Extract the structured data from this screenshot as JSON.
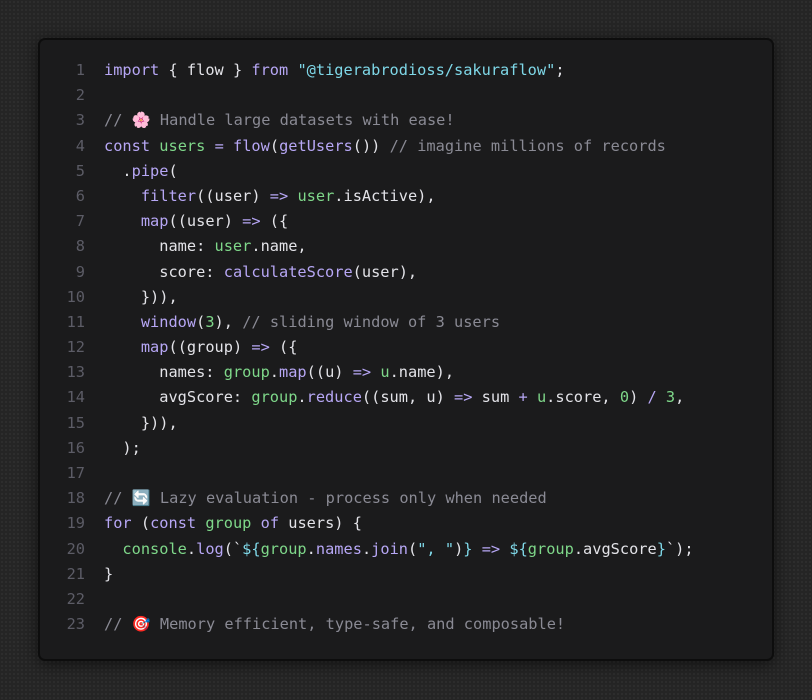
{
  "editor": {
    "lines": [
      {
        "n": "1",
        "tokens": [
          [
            "kw",
            "import"
          ],
          [
            "pl",
            " { flow } "
          ],
          [
            "kw",
            "from"
          ],
          [
            "pl",
            " "
          ],
          [
            "str",
            "\"@tigerabrodioss/sakuraflow\""
          ],
          [
            "pl",
            ";"
          ]
        ]
      },
      {
        "n": "2",
        "tokens": []
      },
      {
        "n": "3",
        "tokens": [
          [
            "cm",
            "// "
          ],
          [
            "emoji",
            "🌸"
          ],
          [
            "cm",
            " Handle large datasets with ease!"
          ]
        ]
      },
      {
        "n": "4",
        "tokens": [
          [
            "kw",
            "const"
          ],
          [
            "pl",
            " "
          ],
          [
            "vr",
            "users"
          ],
          [
            "pl",
            " "
          ],
          [
            "op",
            "="
          ],
          [
            "pl",
            " "
          ],
          [
            "fn",
            "flow"
          ],
          [
            "pl",
            "("
          ],
          [
            "fn",
            "getUsers"
          ],
          [
            "pl",
            "()) "
          ],
          [
            "cm",
            "// imagine millions of records"
          ]
        ]
      },
      {
        "n": "5",
        "tokens": [
          [
            "pl",
            "  ."
          ],
          [
            "fn",
            "pipe"
          ],
          [
            "pl",
            "("
          ]
        ]
      },
      {
        "n": "6",
        "tokens": [
          [
            "pl",
            "    "
          ],
          [
            "fn",
            "filter"
          ],
          [
            "pl",
            "((user) "
          ],
          [
            "op",
            "=>"
          ],
          [
            "pl",
            " "
          ],
          [
            "vr",
            "user"
          ],
          [
            "pl",
            ".isActive),"
          ]
        ]
      },
      {
        "n": "7",
        "tokens": [
          [
            "pl",
            "    "
          ],
          [
            "fn",
            "map"
          ],
          [
            "pl",
            "((user) "
          ],
          [
            "op",
            "=>"
          ],
          [
            "pl",
            " ({"
          ]
        ]
      },
      {
        "n": "8",
        "tokens": [
          [
            "pl",
            "      name: "
          ],
          [
            "vr",
            "user"
          ],
          [
            "pl",
            ".name,"
          ]
        ]
      },
      {
        "n": "9",
        "tokens": [
          [
            "pl",
            "      score: "
          ],
          [
            "fn",
            "calculateScore"
          ],
          [
            "pl",
            "(user),"
          ]
        ]
      },
      {
        "n": "10",
        "tokens": [
          [
            "pl",
            "    })),"
          ]
        ]
      },
      {
        "n": "11",
        "tokens": [
          [
            "pl",
            "    "
          ],
          [
            "fn",
            "window"
          ],
          [
            "pl",
            "("
          ],
          [
            "num",
            "3"
          ],
          [
            "pl",
            "), "
          ],
          [
            "cm",
            "// sliding window of 3 users"
          ]
        ]
      },
      {
        "n": "12",
        "tokens": [
          [
            "pl",
            "    "
          ],
          [
            "fn",
            "map"
          ],
          [
            "pl",
            "((group) "
          ],
          [
            "op",
            "=>"
          ],
          [
            "pl",
            " ({"
          ]
        ]
      },
      {
        "n": "13",
        "tokens": [
          [
            "pl",
            "      names: "
          ],
          [
            "vr",
            "group"
          ],
          [
            "pl",
            "."
          ],
          [
            "fn",
            "map"
          ],
          [
            "pl",
            "((u) "
          ],
          [
            "op",
            "=>"
          ],
          [
            "pl",
            " "
          ],
          [
            "vr",
            "u"
          ],
          [
            "pl",
            ".name),"
          ]
        ]
      },
      {
        "n": "14",
        "tokens": [
          [
            "pl",
            "      avgScore: "
          ],
          [
            "vr",
            "group"
          ],
          [
            "pl",
            "."
          ],
          [
            "fn",
            "reduce"
          ],
          [
            "pl",
            "((sum, u) "
          ],
          [
            "op",
            "=>"
          ],
          [
            "pl",
            " sum "
          ],
          [
            "op",
            "+"
          ],
          [
            "pl",
            " "
          ],
          [
            "vr",
            "u"
          ],
          [
            "pl",
            ".score, "
          ],
          [
            "num",
            "0"
          ],
          [
            "pl",
            ") "
          ],
          [
            "op",
            "/"
          ],
          [
            "pl",
            " "
          ],
          [
            "num",
            "3"
          ],
          [
            "pl",
            ","
          ]
        ]
      },
      {
        "n": "15",
        "tokens": [
          [
            "pl",
            "    })),"
          ]
        ]
      },
      {
        "n": "16",
        "tokens": [
          [
            "pl",
            "  );"
          ]
        ]
      },
      {
        "n": "17",
        "tokens": []
      },
      {
        "n": "18",
        "tokens": [
          [
            "cm",
            "// "
          ],
          [
            "emoji",
            "🔄"
          ],
          [
            "cm",
            " Lazy evaluation - process only when needed"
          ]
        ]
      },
      {
        "n": "19",
        "tokens": [
          [
            "kw",
            "for"
          ],
          [
            "pl",
            " ("
          ],
          [
            "kw",
            "const"
          ],
          [
            "pl",
            " "
          ],
          [
            "vr",
            "group"
          ],
          [
            "pl",
            " "
          ],
          [
            "kw",
            "of"
          ],
          [
            "pl",
            " users) {"
          ]
        ]
      },
      {
        "n": "20",
        "tokens": [
          [
            "pl",
            "  "
          ],
          [
            "vr",
            "console"
          ],
          [
            "pl",
            "."
          ],
          [
            "fn",
            "log"
          ],
          [
            "pl",
            "(`"
          ],
          [
            "str",
            "${"
          ],
          [
            "vr",
            "group"
          ],
          [
            "pl",
            "."
          ],
          [
            "fn",
            "names"
          ],
          [
            "pl",
            "."
          ],
          [
            "fn",
            "join"
          ],
          [
            "pl",
            "("
          ],
          [
            "str",
            "\", \""
          ],
          [
            "pl",
            ")"
          ],
          [
            "str",
            "}"
          ],
          [
            "pl",
            " "
          ],
          [
            "op",
            "=>"
          ],
          [
            "pl",
            " "
          ],
          [
            "str",
            "${"
          ],
          [
            "vr",
            "group"
          ],
          [
            "pl",
            ".avgScore"
          ],
          [
            "str",
            "}"
          ],
          [
            "pl",
            "`);"
          ]
        ]
      },
      {
        "n": "21",
        "tokens": [
          [
            "pl",
            "}"
          ]
        ]
      },
      {
        "n": "22",
        "tokens": []
      },
      {
        "n": "23",
        "tokens": [
          [
            "cm",
            "// "
          ],
          [
            "emoji",
            "🎯"
          ],
          [
            "cm",
            " Memory efficient, type-safe, and composable!"
          ]
        ]
      }
    ]
  }
}
